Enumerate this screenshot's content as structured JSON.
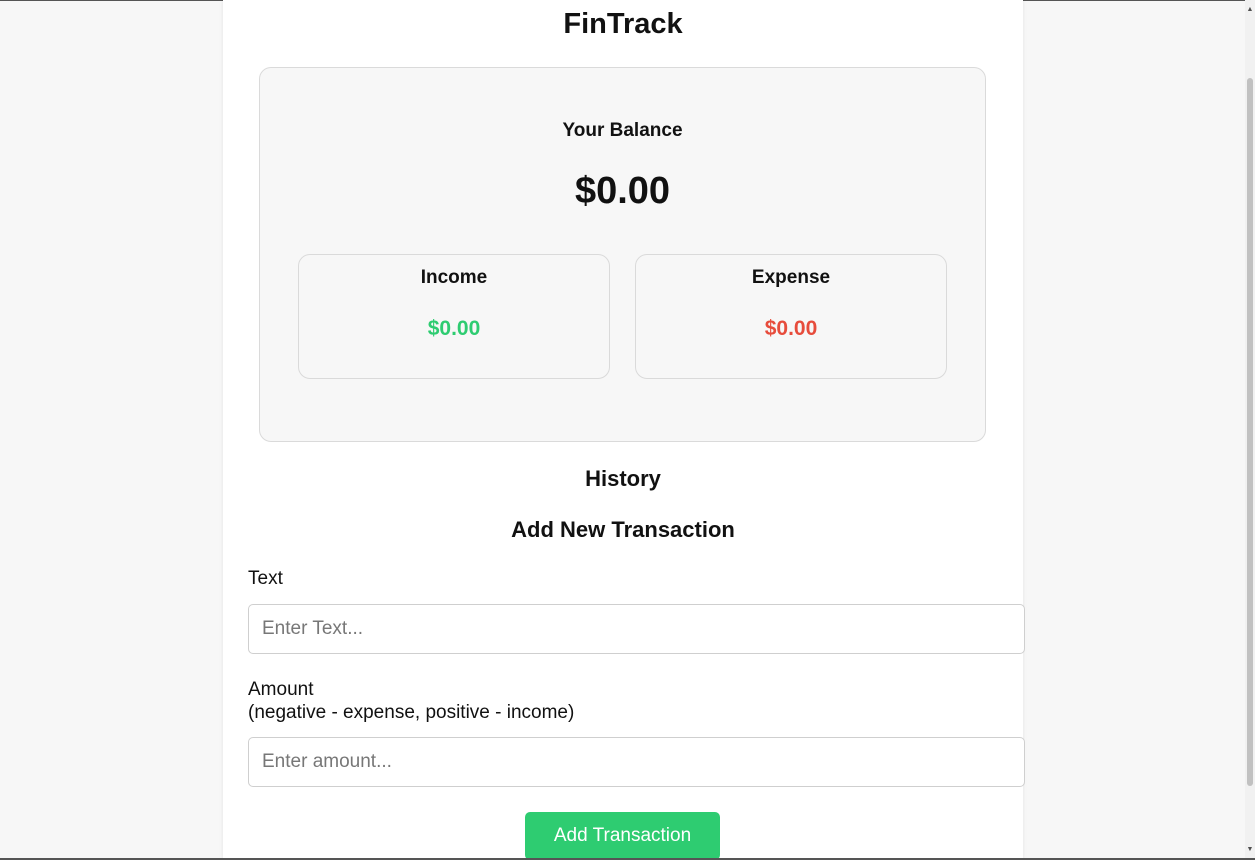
{
  "app": {
    "title": "FinTrack"
  },
  "balance": {
    "label": "Your Balance",
    "value": "$0.00",
    "income": {
      "label": "Income",
      "value": "$0.00",
      "color": "#2ecc71"
    },
    "expense": {
      "label": "Expense",
      "value": "$0.00",
      "color": "#e74c3c"
    }
  },
  "history": {
    "title": "History"
  },
  "form": {
    "title": "Add New Transaction",
    "text_label": "Text",
    "text_placeholder": "Enter Text...",
    "amount_label": "Amount",
    "amount_hint": "(negative - expense, positive - income)",
    "amount_placeholder": "Enter amount...",
    "submit_label": "Add Transaction",
    "submit_color": "#2ecc71"
  },
  "icons": {
    "scroll_up": "triangle-up-icon",
    "scroll_down": "triangle-down-icon"
  }
}
